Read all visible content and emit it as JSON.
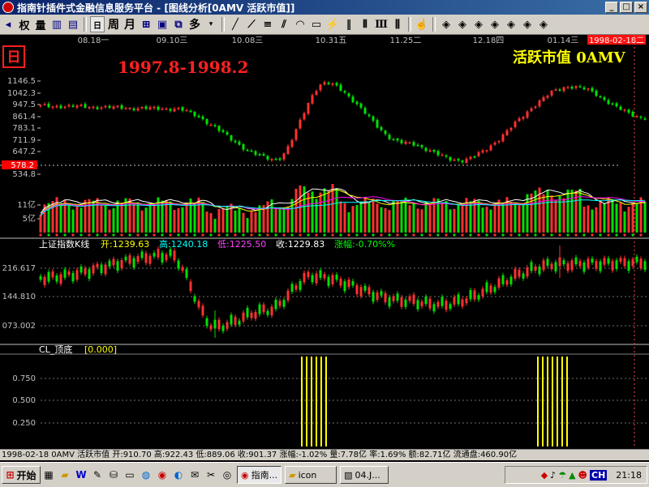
{
  "window": {
    "title": "指南针插件式金融信息服务平台 - [图线分析[0AMV 活跃市值]]",
    "controls": [
      "_",
      "□",
      "×"
    ]
  },
  "toolbar": {
    "period_buttons": [
      "日",
      "周",
      "月"
    ],
    "more_label": "多",
    "icons": [
      "left-arrow-icon",
      "right-arrow-icon",
      "zoom-icon",
      "line-tool-icon",
      "parallel-line-icon",
      "channel-icon",
      "rect-icon",
      "fib-icon",
      "period-line-icon",
      "cursor-icon",
      "diamond-icon"
    ]
  },
  "chart": {
    "date_ticks": [
      "08.18一",
      "09.10三",
      "10.08三",
      "10.31五",
      "11.25二",
      "12.18四",
      "01.14三"
    ],
    "current_date": "1998-02-18二",
    "period_badge": "日",
    "annotation_range": "1997.8-1998.2",
    "annotation_title": "活跃市值 0AMV",
    "colors": {
      "up": "#ff3030",
      "down": "#00e000",
      "ma1": "#ffffff",
      "ma2": "#ffff00",
      "ma3": "#ff00ff",
      "ma4": "#00ffff",
      "signal": "#ffff00",
      "price_tag": "#ff0000"
    },
    "price_axis": [
      "1146.5",
      "1042.3",
      "947.5",
      "861.4",
      "783.1",
      "711.9",
      "647.2",
      "578.2",
      "534.8"
    ],
    "volume_axis": [
      "11亿",
      "5亿"
    ],
    "index_axis": [
      "216.617",
      "144.810",
      "073.002"
    ],
    "signal_axis": [
      "0.750",
      "0.500",
      "0.250"
    ],
    "index_header": {
      "name": "上证指数K线",
      "open": "开:1239.63",
      "high": "高:1240.18",
      "low": "低:1225.50",
      "close": "收:1229.83",
      "change": "涨幅:-0.70%%"
    },
    "signal_header": {
      "name": "CL_顶底",
      "value": "[0.000]"
    }
  },
  "chart_data": [
    {
      "type": "candlestick",
      "title": "活跃市值 0AMV",
      "x": [
        "1997-08-18",
        "1997-09-10",
        "1997-10-08",
        "1997-10-31",
        "1997-11-25",
        "1997-12-18",
        "1998-01-14",
        "1998-02-18"
      ],
      "close": [
        975,
        958,
        632,
        1122,
        735,
        625,
        1101,
        901.37
      ],
      "ylim": [
        534.8,
        1146.5
      ],
      "reference_line": 578.2,
      "last": {
        "open": 910.7,
        "high": 922.43,
        "low": 889.06,
        "close": 901.37
      }
    },
    {
      "type": "bar",
      "title": "成交量",
      "ylabels": [
        "11亿",
        "5亿"
      ],
      "last_value_yi": 7.78
    },
    {
      "type": "candlestick",
      "title": "上证指数K线",
      "ylim": [
        73.002,
        216.617
      ],
      "last": {
        "open": 1239.63,
        "high": 1240.18,
        "low": 1225.5,
        "close": 1229.83,
        "change_pct": -0.7
      }
    },
    {
      "type": "bar",
      "title": "CL_顶底",
      "ylim": [
        0,
        1
      ],
      "signal_groups": [
        {
          "x": "1997-10-31",
          "value": 1
        },
        {
          "x": "1998-01-14",
          "value": 1
        }
      ]
    }
  ],
  "status": {
    "text": "1998-02-18 0AMV 活跃市值 开:910.70 高:922.43 低:889.06 收:901.37 涨幅:-1.02% 量:7.78亿 率:1.69% 额:82.71亿 流通盘:460.90亿"
  },
  "taskbar": {
    "start_label": "开始",
    "tasks": [
      "指南...",
      "icon",
      "04.J..."
    ],
    "clock": "21:18",
    "ime": "CH"
  }
}
